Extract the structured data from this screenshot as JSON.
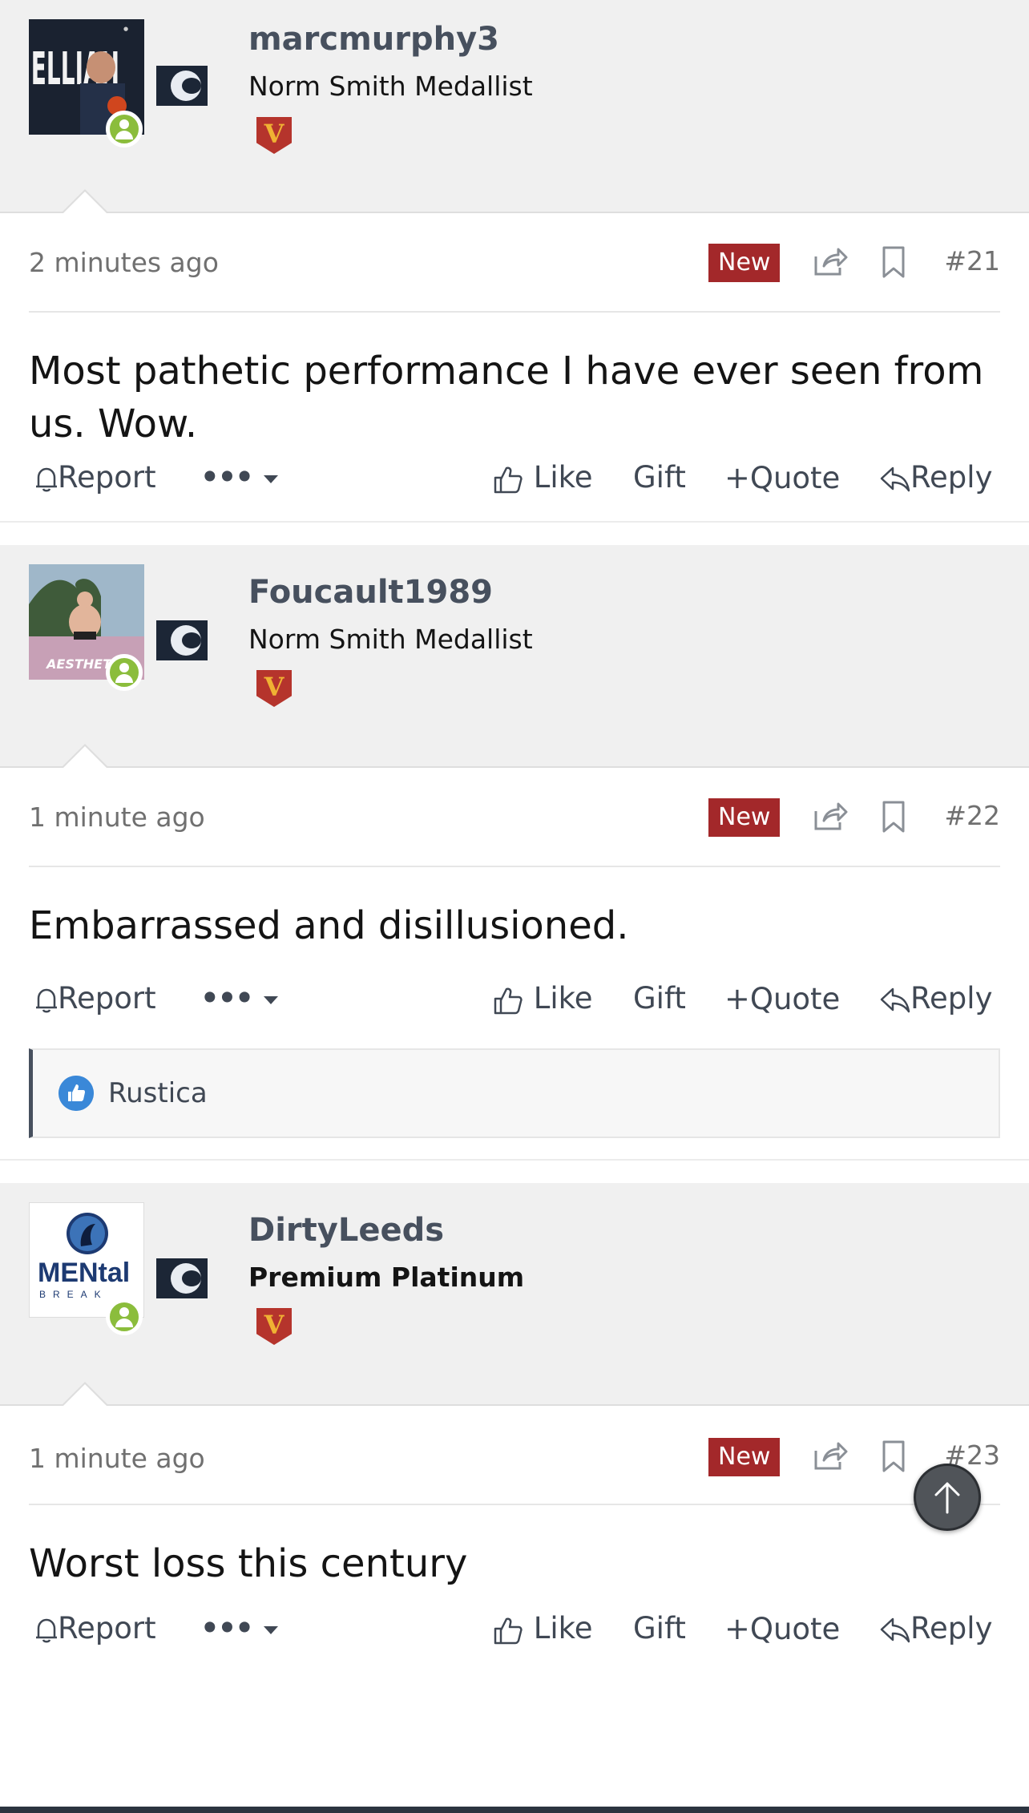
{
  "posts": [
    {
      "username": "marcmurphy3",
      "user_title": "Norm Smith Medallist",
      "badge_letter": "V",
      "time": "2 minutes ago",
      "new_label": "New",
      "post_number": "#21",
      "body": "Most pathetic performance I have ever seen from us. Wow.",
      "reactions": []
    },
    {
      "username": "Foucault1989",
      "user_title": "Norm Smith Medallist",
      "badge_letter": "V",
      "time": "1 minute ago",
      "new_label": "New",
      "post_number": "#22",
      "body": "Embarrassed and disillusioned.",
      "reactions": [
        "Rustica"
      ]
    },
    {
      "username": "DirtyLeeds",
      "user_title": "Premium Platinum",
      "badge_letter": "V",
      "time": "1 minute ago",
      "new_label": "New",
      "post_number": "#23",
      "body": "Worst loss this century",
      "reactions": []
    }
  ],
  "actions": {
    "report": "Report",
    "more": "•••",
    "like": "Like",
    "gift": "Gift",
    "quote": "Quote",
    "reply": "Reply"
  },
  "avatars": {
    "post1_text": "ELLIAH",
    "post2_text": "AESTHET",
    "post3_text": "MENtal",
    "post3_subtext": "BREAK"
  },
  "colors": {
    "username": "#47505e",
    "new_badge": "#a3282a",
    "online": "#8bbd3c",
    "like_reaction": "#3a88d8"
  }
}
